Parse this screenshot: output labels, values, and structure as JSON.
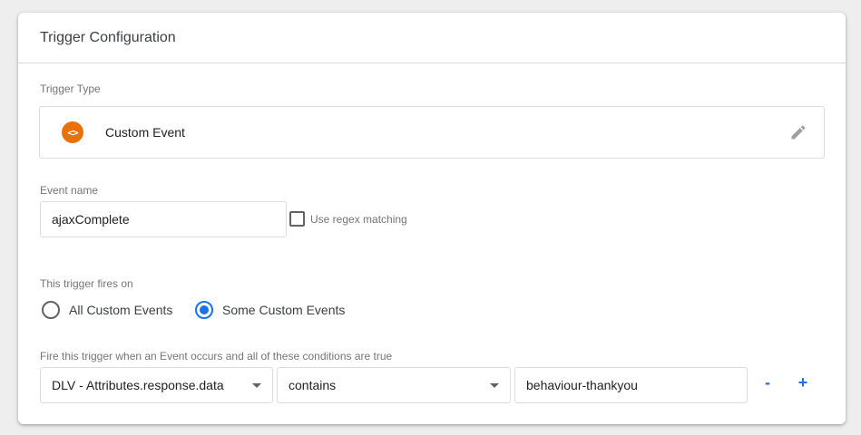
{
  "header": {
    "title": "Trigger Configuration"
  },
  "trigger_type": {
    "label": "Trigger Type",
    "name": "Custom Event",
    "icon": "custom-event-icon",
    "icon_glyph": "<>",
    "icon_color": "#e8710a"
  },
  "event_name": {
    "label": "Event name",
    "value": "ajaxComplete",
    "regex_label": "Use regex matching",
    "regex_checked": false
  },
  "fires_on": {
    "label": "This trigger fires on",
    "options": [
      {
        "label": "All Custom Events",
        "selected": false
      },
      {
        "label": "Some Custom Events",
        "selected": true
      }
    ]
  },
  "conditions": {
    "label": "Fire this trigger when an Event occurs and all of these conditions are true",
    "variable": "DLV - Attributes.response.data",
    "operator": "contains",
    "value": "behaviour-thankyou",
    "remove_label": "-",
    "add_label": "+"
  },
  "colors": {
    "accent": "#1a73e8",
    "trigger_icon": "#e8710a"
  }
}
